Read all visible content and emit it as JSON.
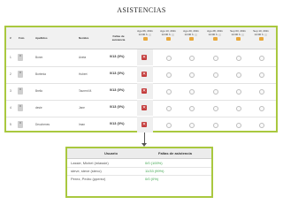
{
  "page_title": "ASISTENCIAS",
  "table": {
    "headers": {
      "num": "#",
      "foto": "Foto",
      "apellidos": "Apellidos",
      "nombre": "Nombre",
      "faltas": "Faltas de asistencia"
    },
    "dates": [
      {
        "line1": "Ago 06, 2011",
        "line2": "14:00 h."
      },
      {
        "line1": "Ago 13, 2011",
        "line2": "14:00 h."
      },
      {
        "line1": "Ago 20, 2011",
        "line2": "14:00 h."
      },
      {
        "line1": "Ago 28, 2011",
        "line2": "14:00 h."
      },
      {
        "line1": "Sep 03, 2011",
        "line2": "14:00 h."
      },
      {
        "line1": "Sep 10, 2011",
        "line2": "14:00 h."
      }
    ],
    "rows": [
      {
        "num": "1",
        "apellidos": "Bonm",
        "nombre": "Anela",
        "faltas": "0/13 (0%)"
      },
      {
        "num": "2",
        "apellidos": "Bortenia",
        "nombre": "Hubert",
        "faltas": "0/13 (0%)"
      },
      {
        "num": "3",
        "apellidos": "Brello",
        "nombre": "Taurent M.",
        "faltas": "0/13 (0%)"
      },
      {
        "num": "4",
        "apellidos": "desie",
        "nombre": "Jane",
        "faltas": "0/13 (0%)"
      },
      {
        "num": "5",
        "apellidos": "Deuchenes",
        "nombre": "Iman",
        "faltas": "0/13 (0%)"
      }
    ],
    "mark_icon": "x-mark-icon",
    "accent_color": "#a9c83f"
  },
  "summary": {
    "headers": {
      "usuario": "Usuario",
      "faltas": "Faltas de asistencia"
    },
    "rows": [
      {
        "usuario": "Lassie, Michel (mlassie)",
        "faltas": "0/0 (100%)"
      },
      {
        "usuario": "steve, steve (stevo)",
        "faltas": "11/33 (99%)"
      },
      {
        "usuario": "Perez, Pedro (pperez)",
        "faltas": "0/0 (0%)"
      }
    ],
    "pct_color": "#3aa34a"
  }
}
